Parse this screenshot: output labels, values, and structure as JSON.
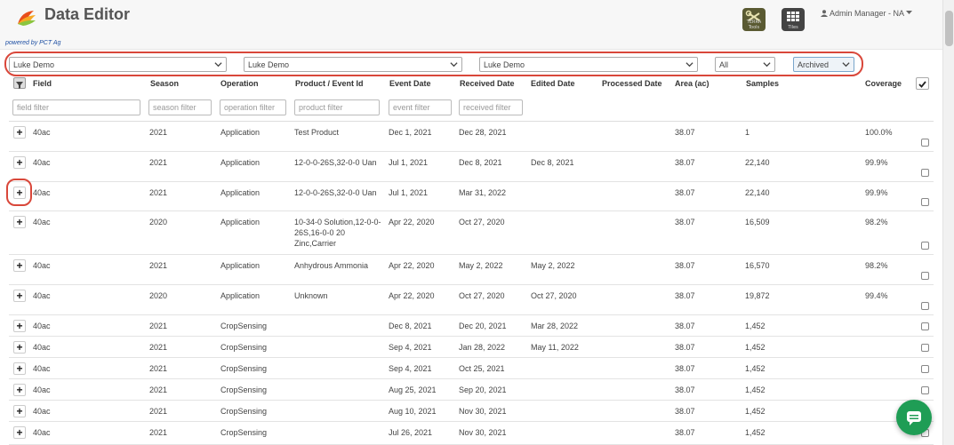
{
  "header": {
    "app_title": "Data Editor",
    "powered_by": "powered by PCT Ag",
    "tools": [
      {
        "label": "TERRA Tools",
        "icon": "terra-tools-icon"
      },
      {
        "label": "Tiles",
        "icon": "grid-icon"
      }
    ],
    "user_label": "Admin Manager - NA"
  },
  "filters": {
    "grower": "Luke Demo",
    "farm": "Luke Demo",
    "field": "Luke Demo",
    "operation": "All",
    "status": "Archived"
  },
  "table": {
    "columns": [
      "Field",
      "Season",
      "Operation",
      "Product / Event Id",
      "Event Date",
      "Received Date",
      "Edited Date",
      "Processed Date",
      "Area (ac)",
      "Samples",
      "Coverage"
    ],
    "filter_placeholders": {
      "field": "field filter",
      "season": "season filter",
      "operation": "operation filter",
      "product": "product filter",
      "event": "event filter",
      "received": "received filter"
    },
    "rows": [
      {
        "field": "40ac",
        "season": "2021",
        "operation": "Application",
        "product": "Test Product",
        "event_date": "Dec 1, 2021",
        "received_date": "Dec 28, 2021",
        "edited_date": "",
        "processed_date": "",
        "area": "38.07",
        "samples": "1",
        "coverage": "100.0%"
      },
      {
        "field": "40ac",
        "season": "2021",
        "operation": "Application",
        "product": "12-0-0-26S,32-0-0 Uan",
        "event_date": "Jul 1, 2021",
        "received_date": "Dec 8, 2021",
        "edited_date": "Dec 8, 2021",
        "processed_date": "",
        "area": "38.07",
        "samples": "22,140",
        "coverage": "99.9%"
      },
      {
        "field": "40ac",
        "season": "2021",
        "operation": "Application",
        "product": "12-0-0-26S,32-0-0 Uan",
        "event_date": "Jul 1, 2021",
        "received_date": "Mar 31, 2022",
        "edited_date": "",
        "processed_date": "",
        "area": "38.07",
        "samples": "22,140",
        "coverage": "99.9%"
      },
      {
        "field": "40ac",
        "season": "2020",
        "operation": "Application",
        "product": "10-34-0 Solution,12-0-0-26S,16-0-0 20 Zinc,Carrier",
        "event_date": "Apr 22, 2020",
        "received_date": "Oct 27, 2020",
        "edited_date": "",
        "processed_date": "",
        "area": "38.07",
        "samples": "16,509",
        "coverage": "98.2%"
      },
      {
        "field": "40ac",
        "season": "2021",
        "operation": "Application",
        "product": "Anhydrous Ammonia",
        "event_date": "Apr 22, 2020",
        "received_date": "May 2, 2022",
        "edited_date": "May 2, 2022",
        "processed_date": "",
        "area": "38.07",
        "samples": "16,570",
        "coverage": "98.2%"
      },
      {
        "field": "40ac",
        "season": "2020",
        "operation": "Application",
        "product": "Unknown",
        "event_date": "Apr 22, 2020",
        "received_date": "Oct 27, 2020",
        "edited_date": "Oct 27, 2020",
        "processed_date": "",
        "area": "38.07",
        "samples": "19,872",
        "coverage": "99.4%"
      },
      {
        "field": "40ac",
        "season": "2021",
        "operation": "CropSensing",
        "product": "",
        "event_date": "Dec 8, 2021",
        "received_date": "Dec 20, 2021",
        "edited_date": "Mar 28, 2022",
        "processed_date": "",
        "area": "38.07",
        "samples": "1,452",
        "coverage": ""
      },
      {
        "field": "40ac",
        "season": "2021",
        "operation": "CropSensing",
        "product": "",
        "event_date": "Sep 4, 2021",
        "received_date": "Jan 28, 2022",
        "edited_date": "May 11, 2022",
        "processed_date": "",
        "area": "38.07",
        "samples": "1,452",
        "coverage": ""
      },
      {
        "field": "40ac",
        "season": "2021",
        "operation": "CropSensing",
        "product": "",
        "event_date": "Sep 4, 2021",
        "received_date": "Oct 25, 2021",
        "edited_date": "",
        "processed_date": "",
        "area": "38.07",
        "samples": "1,452",
        "coverage": ""
      },
      {
        "field": "40ac",
        "season": "2021",
        "operation": "CropSensing",
        "product": "",
        "event_date": "Aug 25, 2021",
        "received_date": "Sep 20, 2021",
        "edited_date": "",
        "processed_date": "",
        "area": "38.07",
        "samples": "1,452",
        "coverage": ""
      },
      {
        "field": "40ac",
        "season": "2021",
        "operation": "CropSensing",
        "product": "",
        "event_date": "Aug 10, 2021",
        "received_date": "Nov 30, 2021",
        "edited_date": "",
        "processed_date": "",
        "area": "38.07",
        "samples": "1,452",
        "coverage": ""
      },
      {
        "field": "40ac",
        "season": "2021",
        "operation": "CropSensing",
        "product": "",
        "event_date": "Jul 26, 2021",
        "received_date": "Nov 30, 2021",
        "edited_date": "",
        "processed_date": "",
        "area": "38.07",
        "samples": "1,452",
        "coverage": ""
      }
    ]
  },
  "annotations": {
    "highlight_color": "#d9473a"
  },
  "chat": {
    "icon": "chat-icon",
    "color": "#1f9d55"
  }
}
